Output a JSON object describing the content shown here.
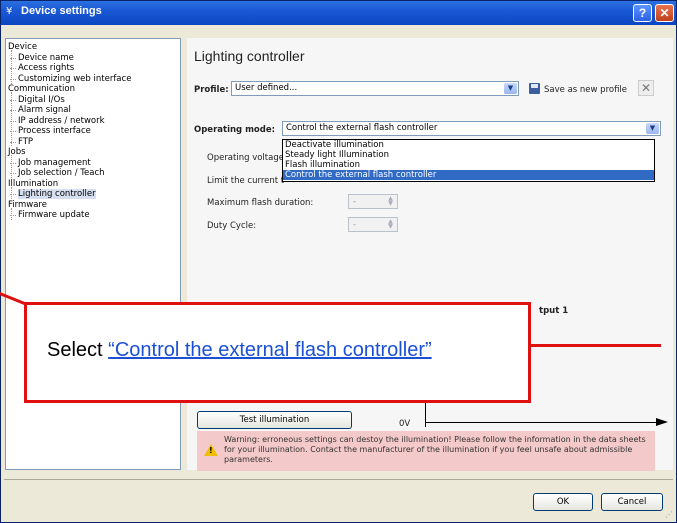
{
  "window": {
    "title": "Device settings",
    "help_label": "?",
    "close_label": "✕"
  },
  "tree": [
    {
      "label": "Device",
      "level": 0
    },
    {
      "label": "Device name",
      "level": 1
    },
    {
      "label": "Access rights",
      "level": 1
    },
    {
      "label": "Customizing web interface",
      "level": 1
    },
    {
      "label": "Communication",
      "level": 0
    },
    {
      "label": "Digital I/Os",
      "level": 1
    },
    {
      "label": "Alarm signal",
      "level": 1
    },
    {
      "label": "IP address / network",
      "level": 1
    },
    {
      "label": "Process interface",
      "level": 1
    },
    {
      "label": "FTP",
      "level": 1
    },
    {
      "label": "Jobs",
      "level": 0
    },
    {
      "label": "Job management",
      "level": 1
    },
    {
      "label": "Job selection / Teach",
      "level": 1
    },
    {
      "label": "Illumination",
      "level": 0
    },
    {
      "label": "Lighting controller",
      "level": 1,
      "selected": true
    },
    {
      "label": "Firmware",
      "level": 0
    },
    {
      "label": "Firmware update",
      "level": 1
    }
  ],
  "main": {
    "heading": "Lighting controller",
    "profile_label": "Profile:",
    "profile_value": "User defined...",
    "save_profile_label": "Save as new profile",
    "mode_label": "Operating mode:",
    "mode_value": "Control the external flash controller",
    "mode_options": [
      "Deactivate illumination",
      "Steady light Illumination",
      "Flash illumination",
      "Control the external flash controller"
    ],
    "selected_option_index": 3,
    "operating_voltage_label": "Operating voltage",
    "limit_current_label": "Limit the current t",
    "max_flash_label": "Maximum flash duration:",
    "max_flash_value": "-",
    "duty_cycle_label": "Duty Cycle:",
    "duty_cycle_value": "-",
    "output_label": "tput 1",
    "test_button": "Test illumination",
    "axis_zero": "0V",
    "warning": "Warning:  erroneous settings can destoy the illumination! Please follow the information in the data sheets for your illumination. Contact the manufacturer of the illumination if you feel unsafe about admissible parameters."
  },
  "callout": {
    "prefix": "Select ",
    "link_text": "“Control the external flash controller”"
  },
  "buttons": {
    "ok": "OK",
    "cancel": "Cancel"
  },
  "colors": {
    "titlebar": "#0b46c0",
    "callout_border": "#e01010",
    "link": "#1b4fd6",
    "warning_bg": "#f4c9c9",
    "selection": "#316ac5"
  }
}
